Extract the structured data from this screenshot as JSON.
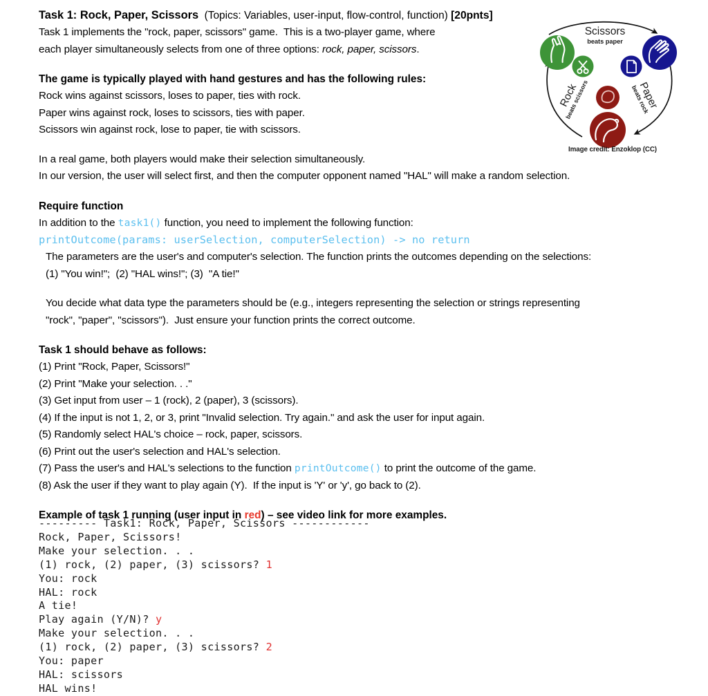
{
  "document": {
    "title": {
      "main": "Task 1: Rock, Paper, Scissors",
      "topics": "  (Topics: Variables, user-input, flow-control, function) ",
      "points": "[20pnts]"
    },
    "intro": [
      "Task 1 implements the \"rock, paper, scissors\" game.  This is a two-player game, where",
      "each player simultaneously selects from one of three options: "
    ],
    "intro_options_italic": "rock, paper, scissors",
    "intro_options_tail": ".",
    "rules_heading": "The game is typically played with hand gestures and has the following rules:",
    "rules": [
      "Rock wins against scissors, loses to paper, ties with rock.",
      "Paper wins against rock, loses to scissors, ties with paper.",
      "Scissors win against rock, lose to paper, tie with scissors."
    ],
    "real_game": [
      "In a real game, both players would make their selection simultaneously.",
      "In our version, the user will select first, and then the computer opponent named \"HAL\" will make a random selection."
    ],
    "require_heading": "Require function",
    "require_line_pre": "In addition to the ",
    "require_code_inline": "task1()",
    "require_line_post": " function, you need to implement the following function:",
    "signature": "printOutcome(params: userSelection, computerSelection) -> no return",
    "params_desc": "The parameters are the user's and computer's selection. The function prints the outcomes depending on the selections:",
    "outcomes_list": "(1) \"You win!\";  (2) \"HAL wins!\"; (3)  \"A tie!\"",
    "datatype_note": [
      "You decide what data type the parameters should be (e.g., integers representing the selection or strings representing",
      "\"rock\", \"paper\", \"scissors\").  Just ensure your function prints the correct outcome."
    ],
    "behave_heading": "Task 1 should behave as follows:",
    "steps": [
      "(1) Print \"Rock, Paper, Scissors!\"",
      "(2) Print \"Make your selection. . .\"",
      "(3) Get input from user – 1 (rock), 2 (paper), 3 (scissors).",
      "(4) If the input is not 1, 2, or 3, print \"Invalid selection. Try again.\" and ask the user for input again.",
      "(5) Randomly select HAL's choice – rock, paper, scissors.",
      "(6) Print out the user's selection and HAL's selection.",
      "(8) Ask the user if they want to play again (Y).  If the input is 'Y' or 'y', go back to (2)."
    ],
    "step7": {
      "pre": "(7) Pass the user's and HAL's selections to the function ",
      "code": "printOutcome()",
      "post": " to print the outcome of the game."
    },
    "example_heading": {
      "pre": "Example of task 1 running (user input in ",
      "red_word": "red",
      "post": ") – see video link for more examples."
    }
  },
  "console": {
    "lines": [
      {
        "text": "--------- Task1: Rock, Paper, Scissors ------------",
        "input": ""
      },
      {
        "text": "Rock, Paper, Scissors!",
        "input": ""
      },
      {
        "text": "Make your selection. . .",
        "input": ""
      },
      {
        "text": "(1) rock, (2) paper, (3) scissors? ",
        "input": "1"
      },
      {
        "text": "You: rock",
        "input": ""
      },
      {
        "text": "HAL: rock",
        "input": ""
      },
      {
        "text": "A tie!",
        "input": ""
      },
      {
        "text": "Play again (Y/N)? ",
        "input": "y"
      },
      {
        "text": "Make your selection. . .",
        "input": ""
      },
      {
        "text": "(1) rock, (2) paper, (3) scissors? ",
        "input": "2"
      },
      {
        "text": "You: paper",
        "input": ""
      },
      {
        "text": "HAL: scissors",
        "input": ""
      },
      {
        "text": "HAL wins!",
        "input": ""
      }
    ]
  },
  "diagram": {
    "labels": {
      "scissors_main": "Scissors",
      "scissors_sub": "beats paper",
      "rock_main": "Rock",
      "rock_sub": "beats scissors",
      "paper_main": "Paper",
      "paper_sub": "beats rock"
    },
    "credit": "Image credit: Enzoklop (CC)",
    "colors": {
      "green": "#3E9438",
      "blue": "#161690",
      "red": "#8E1A14",
      "stroke": "#ffffff",
      "arrow": "#111111"
    }
  },
  "theme": {
    "code_blue": "#5BBFEF",
    "input_red": "#E03030",
    "text": "#000000",
    "background": "#ffffff"
  }
}
